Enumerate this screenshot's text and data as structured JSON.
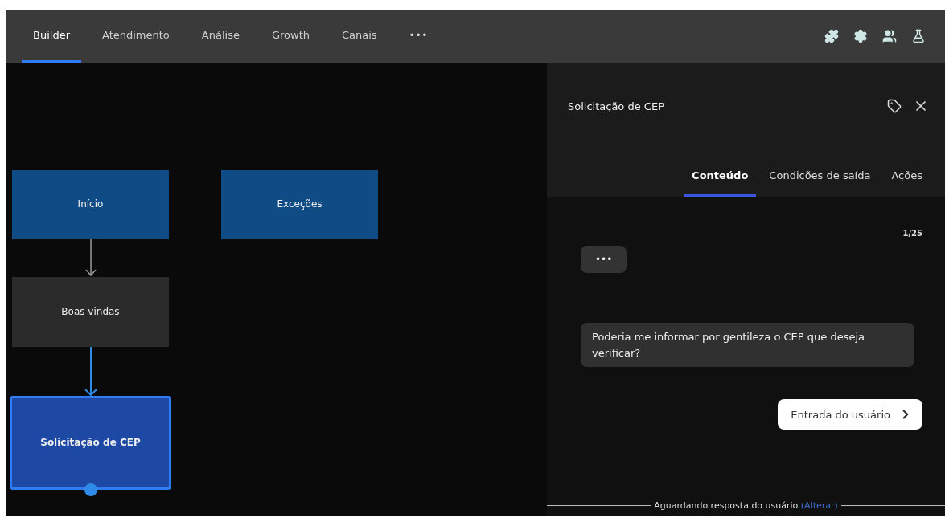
{
  "nav": {
    "tabs": [
      {
        "label": "Builder",
        "selected": true
      },
      {
        "label": "Atendimento",
        "selected": false
      },
      {
        "label": "Análise",
        "selected": false
      },
      {
        "label": "Growth",
        "selected": false
      },
      {
        "label": "Canais",
        "selected": false
      }
    ],
    "more": "•••"
  },
  "canvas": {
    "nodes": [
      {
        "label": "Início",
        "color": "#0f4c85",
        "selected": false
      },
      {
        "label": "Exceções",
        "color": "#0f4c85",
        "selected": false
      },
      {
        "label": "Boas vindas",
        "color": "#2b2b2b",
        "selected": false
      },
      {
        "label": "Solicitação de CEP",
        "color": "#1d48a3",
        "selected": true
      }
    ]
  },
  "panel": {
    "title": "Solicitação de CEP",
    "tabs": [
      {
        "label": "Conteúdo",
        "selected": true
      },
      {
        "label": "Condições de saída",
        "selected": false
      },
      {
        "label": "Ações",
        "selected": false
      }
    ],
    "counter": "1/25",
    "typing": "•••",
    "message": "Poderia me informar por gentileza o CEP que deseja verificar?",
    "input_button": "Entrada do usuário",
    "status_text": "Aguardando resposta do usuário",
    "status_link": "(Alterar)"
  }
}
